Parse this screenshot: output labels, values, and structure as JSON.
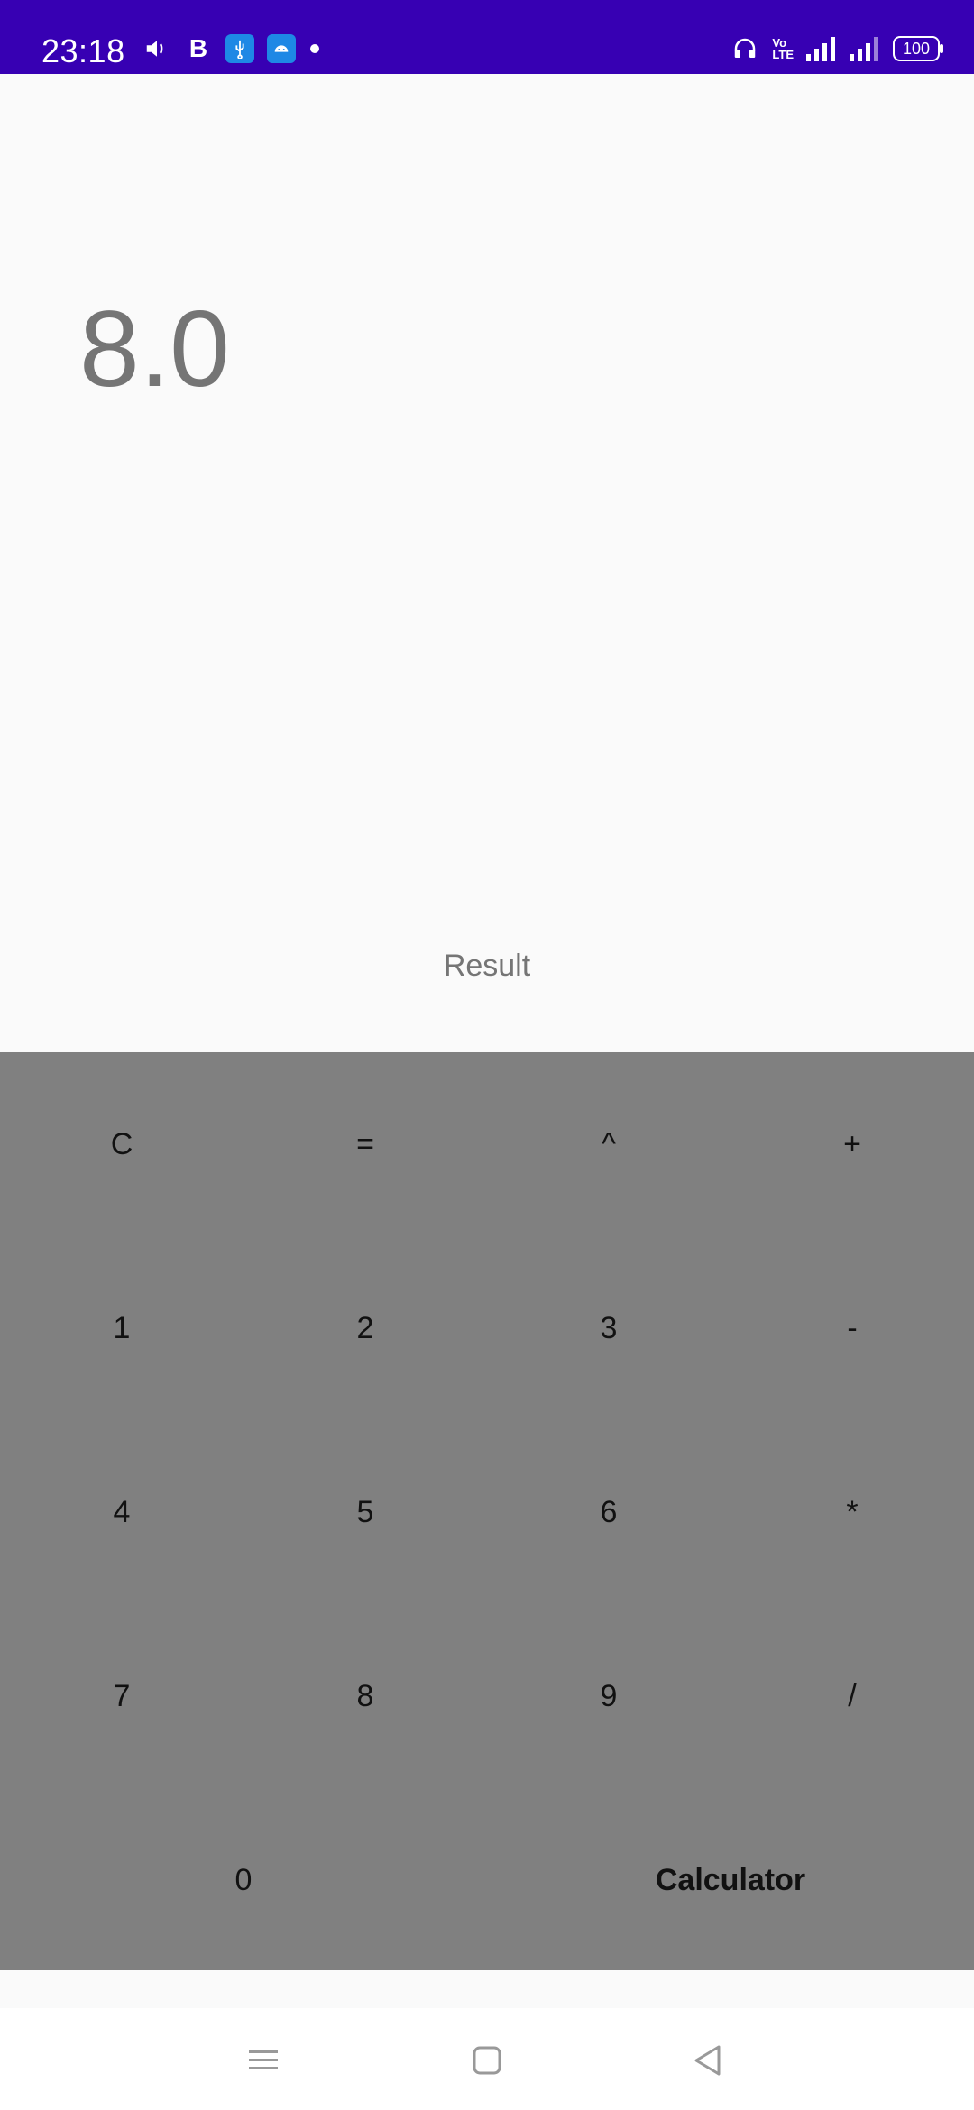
{
  "status_bar": {
    "time": "23:18",
    "battery": "100",
    "volte_top": "Vo",
    "volte_bottom": "LTE",
    "left_icons": [
      "volume-icon",
      "b-icon",
      "usb-icon",
      "android-icon",
      "notification-dot-icon"
    ],
    "right_icons": [
      "headset-icon",
      "volte-icon",
      "signal-icon",
      "signal-4g-icon",
      "battery-icon"
    ],
    "colors": {
      "background": "#3700b3",
      "badge": "#1e88e5"
    }
  },
  "display": {
    "value": "8.0",
    "result_label": "Result"
  },
  "keypad": {
    "rows": [
      [
        "C",
        "=",
        "^",
        "+"
      ],
      [
        "1",
        "2",
        "3",
        "-"
      ],
      [
        "4",
        "5",
        "6",
        "*"
      ],
      [
        "7",
        "8",
        "9",
        "/"
      ]
    ],
    "bottom_row": [
      "0",
      "Calculator"
    ],
    "background": "#808080"
  },
  "nav_bar": {
    "buttons": [
      "menu-icon",
      "home-icon",
      "back-icon"
    ]
  }
}
